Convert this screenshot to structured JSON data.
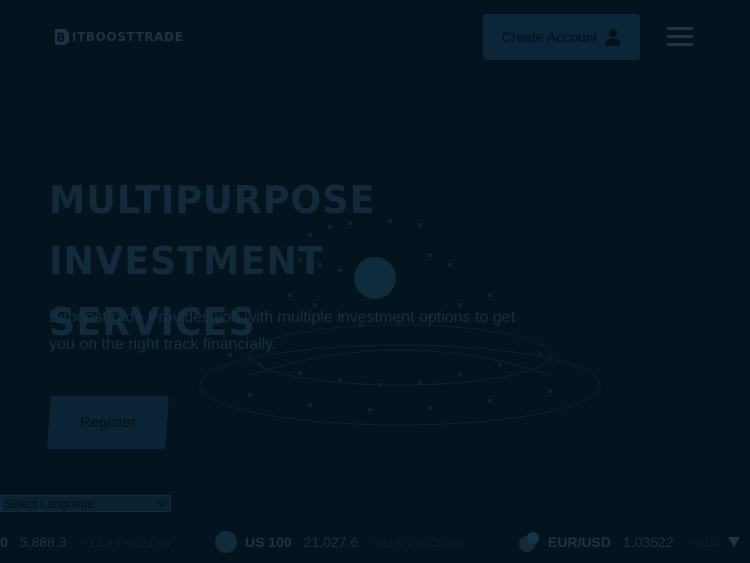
{
  "header": {
    "logo_text": "ITBOOSTTRADE",
    "create_account_label": "Create Account"
  },
  "hero": {
    "title_line1": "MULTIPURPOSE INVESTMENT",
    "title_line2": "SERVICES",
    "subtitle": "Bitboosttrade Provides you with multiple investment options to get you on the right track financially.",
    "register_label": "Register"
  },
  "language": {
    "selected": "Select Language"
  },
  "ticker": {
    "items": [
      {
        "symbol": "0",
        "price": "5,888.3",
        "change": "+12.4 (+0.21%)"
      },
      {
        "symbol": "US 100",
        "price": "21,027.6",
        "change": "+41.0 (+0.20%)"
      },
      {
        "symbol": "EUR/USD",
        "price": "1.03522",
        "change": "+0.00"
      }
    ]
  },
  "colors": {
    "background": "#03141e",
    "button": "#0b2638"
  }
}
